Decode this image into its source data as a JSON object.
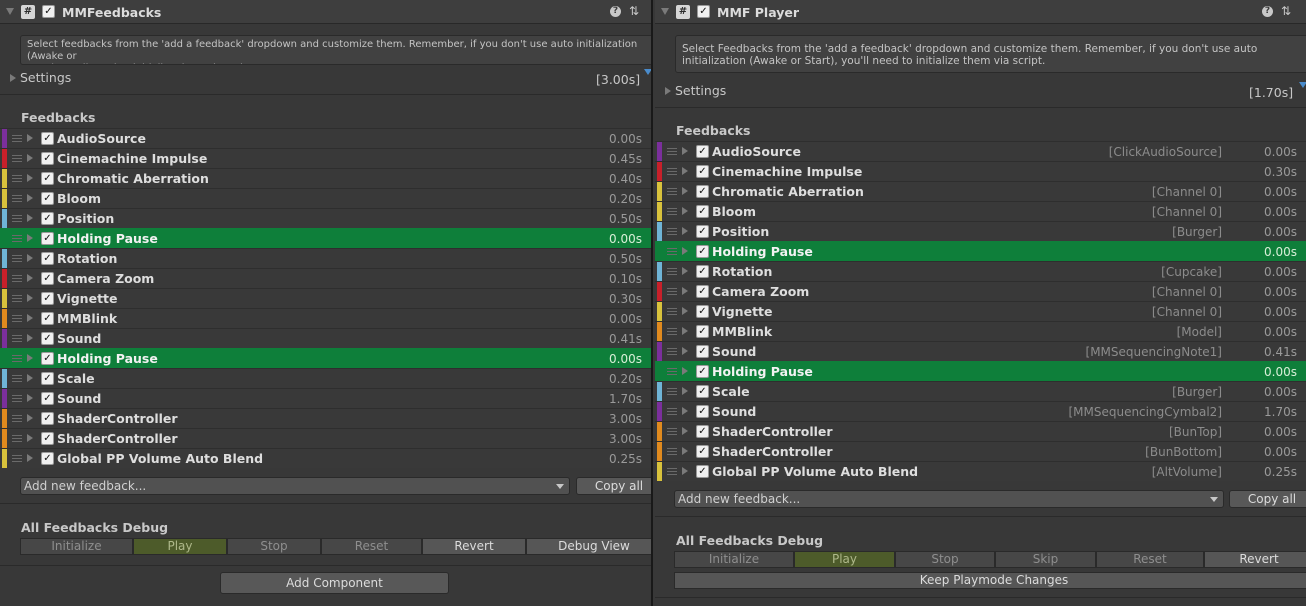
{
  "left": {
    "title": "MMFeedbacks",
    "enabled": true,
    "help_text": "Select feedbacks from the 'add a feedback' dropdown and customize them. Remember, if you don't use auto initialization (Awake or\nStart), you'll need to initialize them via script.",
    "settings_label": "Settings",
    "total_duration": "[3.00s]",
    "feedbacks_label": "Feedbacks",
    "feedbacks": [
      {
        "name": "AudioSource",
        "duration": "0.00s",
        "color": "#7b2f9c",
        "checked": true
      },
      {
        "name": "Cinemachine Impulse",
        "duration": "0.45s",
        "color": "#c8202a",
        "checked": true
      },
      {
        "name": "Chromatic Aberration",
        "duration": "0.40s",
        "color": "#d8c23c",
        "checked": true
      },
      {
        "name": "Bloom",
        "duration": "0.20s",
        "color": "#d8c23c",
        "checked": true
      },
      {
        "name": "Position",
        "duration": "0.50s",
        "color": "#6fb4d6",
        "checked": true
      },
      {
        "name": "Holding Pause",
        "duration": "0.00s",
        "color": "#0e7f3a",
        "checked": true,
        "pause": true
      },
      {
        "name": "Rotation",
        "duration": "0.50s",
        "color": "#6fb4d6",
        "checked": true
      },
      {
        "name": "Camera Zoom",
        "duration": "0.10s",
        "color": "#c8202a",
        "checked": true
      },
      {
        "name": "Vignette",
        "duration": "0.30s",
        "color": "#d8c23c",
        "checked": true
      },
      {
        "name": "MMBlink",
        "duration": "0.00s",
        "color": "#e08a1e",
        "checked": true
      },
      {
        "name": "Sound",
        "duration": "0.41s",
        "color": "#7b2f9c",
        "checked": true
      },
      {
        "name": "Holding Pause",
        "duration": "0.00s",
        "color": "#0e7f3a",
        "checked": true,
        "pause": true
      },
      {
        "name": "Scale",
        "duration": "0.20s",
        "color": "#6fb4d6",
        "checked": true
      },
      {
        "name": "Sound",
        "duration": "1.70s",
        "color": "#7b2f9c",
        "checked": true
      },
      {
        "name": "ShaderController",
        "duration": "3.00s",
        "color": "#e08a1e",
        "checked": true
      },
      {
        "name": "ShaderController",
        "duration": "3.00s",
        "color": "#e08a1e",
        "checked": true
      },
      {
        "name": "Global PP Volume Auto Blend",
        "duration": "0.25s",
        "color": "#d8c23c",
        "checked": true
      }
    ],
    "add_feedback_label": "Add new feedback...",
    "copy_all_label": "Copy all",
    "debug_title": "All Feedbacks Debug",
    "debug_buttons": [
      "Initialize",
      "Play",
      "Stop",
      "Reset",
      "Revert",
      "Debug View"
    ],
    "add_component_label": "Add Component"
  },
  "right": {
    "title": "MMF Player",
    "enabled": true,
    "help_text": "Select Feedbacks from the 'add a feedback' dropdown and customize them. Remember, if you don't use auto\ninitialization (Awake or Start), you'll need to initialize them via script.",
    "settings_label": "Settings",
    "total_duration": "[1.70s]",
    "feedbacks_label": "Feedbacks",
    "feedbacks": [
      {
        "name": "AudioSource",
        "channel": "[ClickAudioSource]",
        "duration": "0.00s",
        "color": "#7b2f9c",
        "checked": true
      },
      {
        "name": "Cinemachine Impulse",
        "channel": "",
        "duration": "0.30s",
        "color": "#c8202a",
        "checked": true
      },
      {
        "name": "Chromatic Aberration",
        "channel": "[Channel 0]",
        "duration": "0.00s",
        "color": "#d8c23c",
        "checked": true
      },
      {
        "name": "Bloom",
        "channel": "[Channel 0]",
        "duration": "0.00s",
        "color": "#d8c23c",
        "checked": true
      },
      {
        "name": "Position",
        "channel": "[Burger]",
        "duration": "0.00s",
        "color": "#6fb4d6",
        "checked": true
      },
      {
        "name": "Holding Pause",
        "channel": "",
        "duration": "0.00s",
        "color": "#0e7f3a",
        "checked": true,
        "pause": true
      },
      {
        "name": "Rotation",
        "channel": "[Cupcake]",
        "duration": "0.00s",
        "color": "#6fb4d6",
        "checked": true
      },
      {
        "name": "Camera Zoom",
        "channel": "[Channel 0]",
        "duration": "0.00s",
        "color": "#c8202a",
        "checked": true
      },
      {
        "name": "Vignette",
        "channel": "[Channel 0]",
        "duration": "0.00s",
        "color": "#d8c23c",
        "checked": true
      },
      {
        "name": "MMBlink",
        "channel": "[Model]",
        "duration": "0.00s",
        "color": "#e08a1e",
        "checked": true
      },
      {
        "name": "Sound",
        "channel": "[MMSequencingNote1]",
        "duration": "0.41s",
        "color": "#7b2f9c",
        "checked": true
      },
      {
        "name": "Holding Pause",
        "channel": "",
        "duration": "0.00s",
        "color": "#0e7f3a",
        "checked": true,
        "pause": true
      },
      {
        "name": "Scale",
        "channel": "[Burger]",
        "duration": "0.00s",
        "color": "#6fb4d6",
        "checked": true
      },
      {
        "name": "Sound",
        "channel": "[MMSequencingCymbal2]",
        "duration": "1.70s",
        "color": "#7b2f9c",
        "checked": true
      },
      {
        "name": "ShaderController",
        "channel": "[BunTop]",
        "duration": "0.00s",
        "color": "#e08a1e",
        "checked": true
      },
      {
        "name": "ShaderController",
        "channel": "[BunBottom]",
        "duration": "0.00s",
        "color": "#e08a1e",
        "checked": true
      },
      {
        "name": "Global PP Volume Auto Blend",
        "channel": "[AltVolume]",
        "duration": "0.25s",
        "color": "#d8c23c",
        "checked": true
      }
    ],
    "add_feedback_label": "Add new feedback...",
    "copy_all_label": "Copy all",
    "debug_title": "All Feedbacks Debug",
    "debug_buttons": [
      "Initialize",
      "Play",
      "Stop",
      "Skip",
      "Reset",
      "Revert"
    ],
    "keep_playmode_label": "Keep Playmode Changes"
  },
  "icons": {
    "checkmark": "✓",
    "script": "#",
    "help": "?",
    "presets": "⇅"
  }
}
